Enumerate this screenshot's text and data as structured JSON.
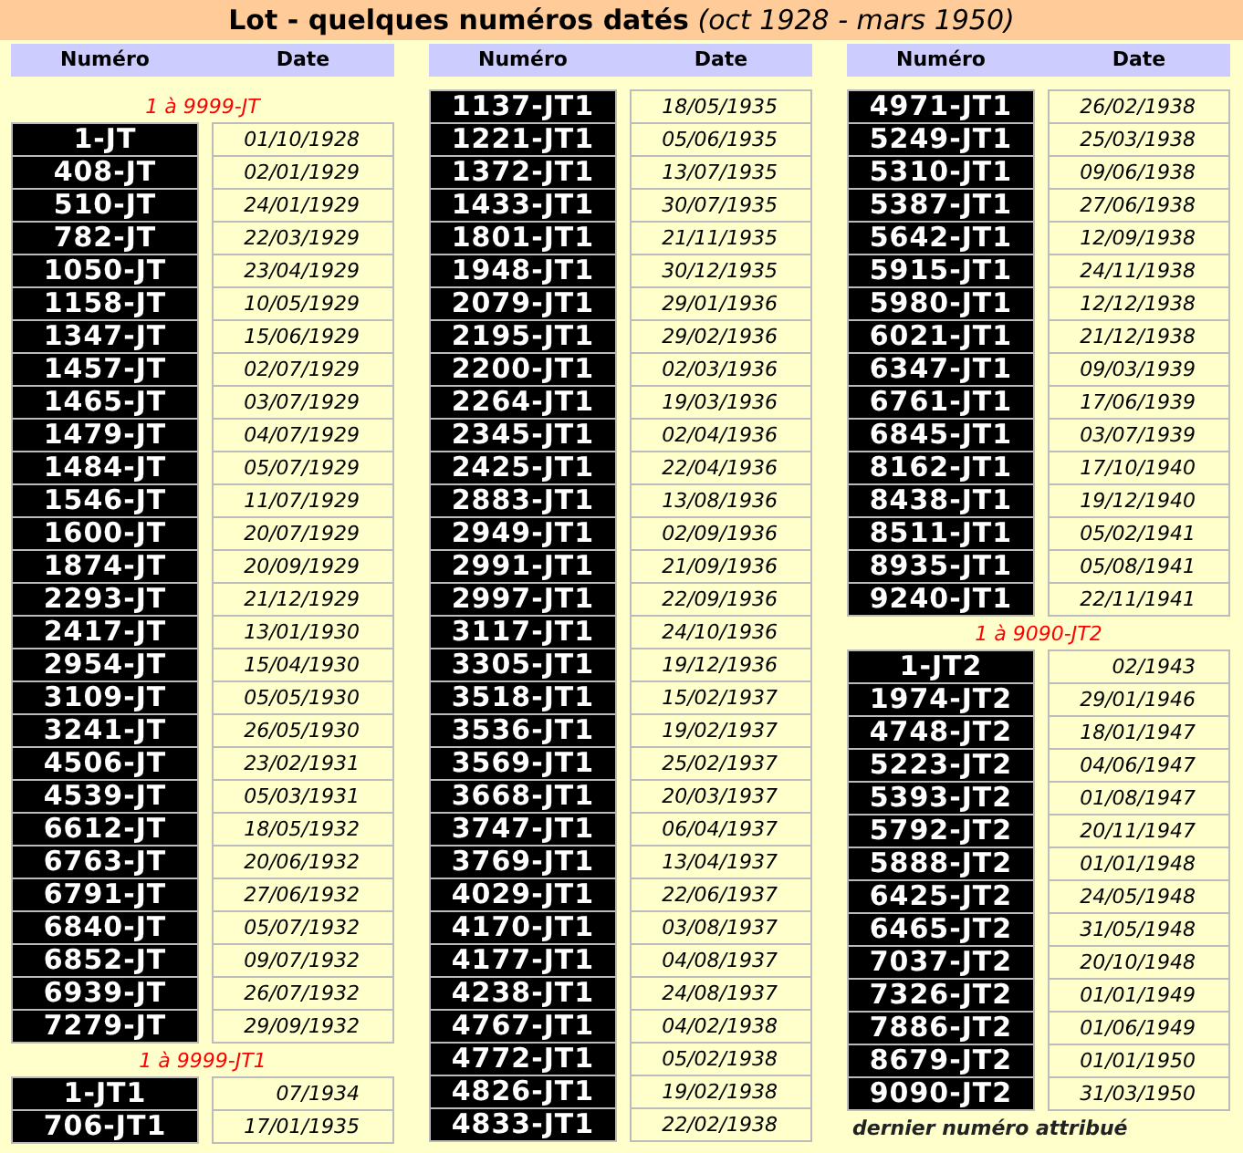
{
  "title": "**Lot - quelques numéros datés** *(oct 1928 - mars 1950)*",
  "columns": [
    {
      "headers": [
        "Numéro",
        "Date"
      ],
      "blocks": [
        {
          "kind": "range",
          "text": "1 à 9999-JT"
        },
        {
          "kind": "table",
          "rows": [
            {
              "number": "1-JT",
              "date": "01/10/1928"
            },
            {
              "number": "408-JT",
              "date": "02/01/1929"
            },
            {
              "number": "510-JT",
              "date": "24/01/1929"
            },
            {
              "number": "782-JT",
              "date": "22/03/1929"
            },
            {
              "number": "1050-JT",
              "date": "23/04/1929"
            },
            {
              "number": "1158-JT",
              "date": "10/05/1929"
            },
            {
              "number": "1347-JT",
              "date": "15/06/1929"
            },
            {
              "number": "1457-JT",
              "date": "02/07/1929"
            },
            {
              "number": "1465-JT",
              "date": "03/07/1929"
            },
            {
              "number": "1479-JT",
              "date": "04/07/1929"
            },
            {
              "number": "1484-JT",
              "date": "05/07/1929"
            },
            {
              "number": "1546-JT",
              "date": "11/07/1929"
            },
            {
              "number": "1600-JT",
              "date": "20/07/1929"
            },
            {
              "number": "1874-JT",
              "date": "20/09/1929"
            },
            {
              "number": "2293-JT",
              "date": "21/12/1929"
            },
            {
              "number": "2417-JT",
              "date": "13/01/1930"
            },
            {
              "number": "2954-JT",
              "date": "15/04/1930"
            },
            {
              "number": "3109-JT",
              "date": "05/05/1930"
            },
            {
              "number": "3241-JT",
              "date": "26/05/1930"
            },
            {
              "number": "4506-JT",
              "date": "23/02/1931"
            },
            {
              "number": "4539-JT",
              "date": "05/03/1931"
            },
            {
              "number": "6612-JT",
              "date": "18/05/1932"
            },
            {
              "number": "6763-JT",
              "date": "20/06/1932"
            },
            {
              "number": "6791-JT",
              "date": "27/06/1932"
            },
            {
              "number": "6840-JT",
              "date": "05/07/1932"
            },
            {
              "number": "6852-JT",
              "date": "09/07/1932"
            },
            {
              "number": "6939-JT",
              "date": "26/07/1932"
            },
            {
              "number": "7279-JT",
              "date": "29/09/1932"
            }
          ]
        },
        {
          "kind": "range",
          "text": "1 à 9999-JT1"
        },
        {
          "kind": "table",
          "rows": [
            {
              "number": "1-JT1",
              "date": "07/1934"
            },
            {
              "number": "706-JT1",
              "date": "17/01/1935"
            }
          ]
        }
      ]
    },
    {
      "headers": [
        "Numéro",
        "Date"
      ],
      "blocks": [
        {
          "kind": "table",
          "rows": [
            {
              "number": "1137-JT1",
              "date": "18/05/1935"
            },
            {
              "number": "1221-JT1",
              "date": "05/06/1935"
            },
            {
              "number": "1372-JT1",
              "date": "13/07/1935"
            },
            {
              "number": "1433-JT1",
              "date": "30/07/1935"
            },
            {
              "number": "1801-JT1",
              "date": "21/11/1935"
            },
            {
              "number": "1948-JT1",
              "date": "30/12/1935"
            },
            {
              "number": "2079-JT1",
              "date": "29/01/1936"
            },
            {
              "number": "2195-JT1",
              "date": "29/02/1936"
            },
            {
              "number": "2200-JT1",
              "date": "02/03/1936"
            },
            {
              "number": "2264-JT1",
              "date": "19/03/1936"
            },
            {
              "number": "2345-JT1",
              "date": "02/04/1936"
            },
            {
              "number": "2425-JT1",
              "date": "22/04/1936"
            },
            {
              "number": "2883-JT1",
              "date": "13/08/1936"
            },
            {
              "number": "2949-JT1",
              "date": "02/09/1936"
            },
            {
              "number": "2991-JT1",
              "date": "21/09/1936"
            },
            {
              "number": "2997-JT1",
              "date": "22/09/1936"
            },
            {
              "number": "3117-JT1",
              "date": "24/10/1936"
            },
            {
              "number": "3305-JT1",
              "date": "19/12/1936"
            },
            {
              "number": "3518-JT1",
              "date": "15/02/1937"
            },
            {
              "number": "3536-JT1",
              "date": "19/02/1937"
            },
            {
              "number": "3569-JT1",
              "date": "25/02/1937"
            },
            {
              "number": "3668-JT1",
              "date": "20/03/1937"
            },
            {
              "number": "3747-JT1",
              "date": "06/04/1937"
            },
            {
              "number": "3769-JT1",
              "date": "13/04/1937"
            },
            {
              "number": "4029-JT1",
              "date": "22/06/1937"
            },
            {
              "number": "4170-JT1",
              "date": "03/08/1937"
            },
            {
              "number": "4177-JT1",
              "date": "04/08/1937"
            },
            {
              "number": "4238-JT1",
              "date": "24/08/1937"
            },
            {
              "number": "4767-JT1",
              "date": "04/02/1938"
            },
            {
              "number": "4772-JT1",
              "date": "05/02/1938"
            },
            {
              "number": "4826-JT1",
              "date": "19/02/1938"
            },
            {
              "number": "4833-JT1",
              "date": "22/02/1938"
            }
          ]
        }
      ]
    },
    {
      "headers": [
        "Numéro",
        "Date"
      ],
      "blocks": [
        {
          "kind": "table",
          "rows": [
            {
              "number": "4971-JT1",
              "date": "26/02/1938"
            },
            {
              "number": "5249-JT1",
              "date": "25/03/1938"
            },
            {
              "number": "5310-JT1",
              "date": "09/06/1938"
            },
            {
              "number": "5387-JT1",
              "date": "27/06/1938"
            },
            {
              "number": "5642-JT1",
              "date": "12/09/1938"
            },
            {
              "number": "5915-JT1",
              "date": "24/11/1938"
            },
            {
              "number": "5980-JT1",
              "date": "12/12/1938"
            },
            {
              "number": "6021-JT1",
              "date": "21/12/1938"
            },
            {
              "number": "6347-JT1",
              "date": "09/03/1939"
            },
            {
              "number": "6761-JT1",
              "date": "17/06/1939"
            },
            {
              "number": "6845-JT1",
              "date": "03/07/1939"
            },
            {
              "number": "8162-JT1",
              "date": "17/10/1940"
            },
            {
              "number": "8438-JT1",
              "date": "19/12/1940"
            },
            {
              "number": "8511-JT1",
              "date": "05/02/1941"
            },
            {
              "number": "8935-JT1",
              "date": "05/08/1941"
            },
            {
              "number": "9240-JT1",
              "date": "22/11/1941"
            }
          ]
        },
        {
          "kind": "range",
          "text": "1 à 9090-JT2"
        },
        {
          "kind": "table",
          "rows": [
            {
              "number": "1-JT2",
              "date": "02/1943"
            },
            {
              "number": "1974-JT2",
              "date": "29/01/1946"
            },
            {
              "number": "4748-JT2",
              "date": "18/01/1947"
            },
            {
              "number": "5223-JT2",
              "date": "04/06/1947"
            },
            {
              "number": "5393-JT2",
              "date": "01/08/1947"
            },
            {
              "number": "5792-JT2",
              "date": "20/11/1947"
            },
            {
              "number": "5888-JT2",
              "date": "01/01/1948"
            },
            {
              "number": "6425-JT2",
              "date": "24/05/1948"
            },
            {
              "number": "6465-JT2",
              "date": "31/05/1948"
            },
            {
              "number": "7037-JT2",
              "date": "20/10/1948"
            },
            {
              "number": "7326-JT2",
              "date": "01/01/1949"
            },
            {
              "number": "7886-JT2",
              "date": "01/06/1949"
            },
            {
              "number": "8679-JT2",
              "date": "01/01/1950"
            },
            {
              "number": "9090-JT2",
              "date": "31/03/1950"
            }
          ]
        },
        {
          "kind": "note",
          "text": "dernier numéro attribué"
        }
      ]
    }
  ]
}
